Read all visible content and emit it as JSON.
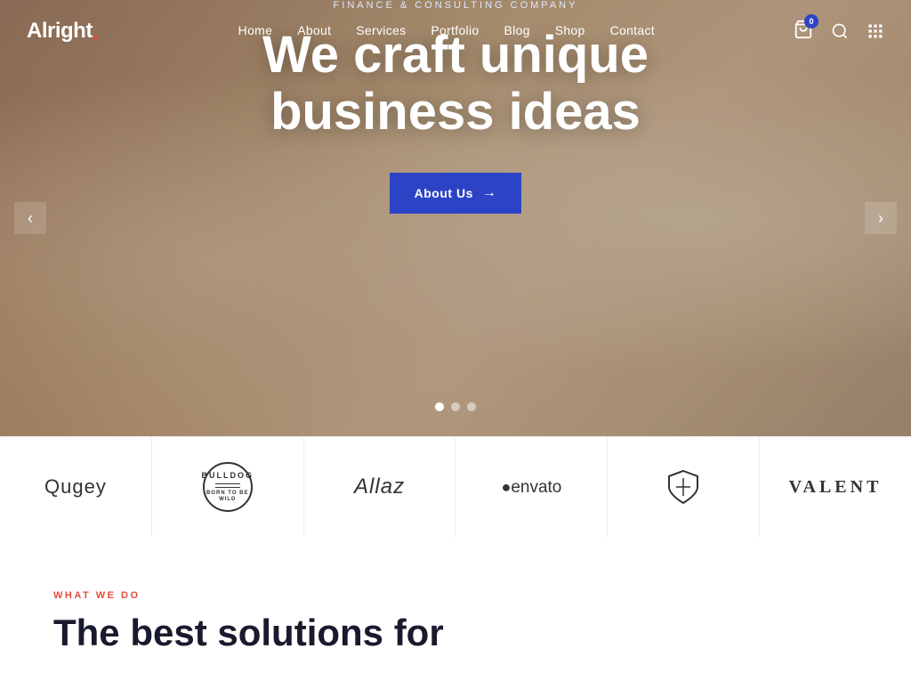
{
  "site": {
    "logo_text": "Alright",
    "logo_dot": ".",
    "cart_count": "0"
  },
  "navbar": {
    "items": [
      {
        "label": "Home",
        "href": "#"
      },
      {
        "label": "About",
        "href": "#"
      },
      {
        "label": "Services",
        "href": "#"
      },
      {
        "label": "Portfolio",
        "href": "#"
      },
      {
        "label": "Blog",
        "href": "#"
      },
      {
        "label": "Shop",
        "href": "#"
      },
      {
        "label": "Contact",
        "href": "#"
      }
    ]
  },
  "hero": {
    "subtitle": "Finance & Consulting Company",
    "title_line1": "We craft unique",
    "title_line2": "business ideas",
    "cta_label": "About Us",
    "arrow": "→",
    "dots": [
      {
        "active": true
      },
      {
        "active": false
      },
      {
        "active": false
      }
    ],
    "prev_arrow": "‹",
    "next_arrow": "›"
  },
  "brands": [
    {
      "id": "qugey",
      "label": "Qugey",
      "style": "normal"
    },
    {
      "id": "bulldog",
      "label": "BULLDOG\nBORN TO BE\nWILD",
      "style": "circle"
    },
    {
      "id": "allaz",
      "label": "Allaz",
      "style": "italic"
    },
    {
      "id": "envato",
      "label": "●envato",
      "style": "normal"
    },
    {
      "id": "shield",
      "label": "⊍",
      "style": "symbol"
    },
    {
      "id": "valent",
      "label": "VALENT",
      "style": "condensed"
    }
  ],
  "what_section": {
    "tag": "What We Do",
    "title_line1": "The best solutions for"
  }
}
